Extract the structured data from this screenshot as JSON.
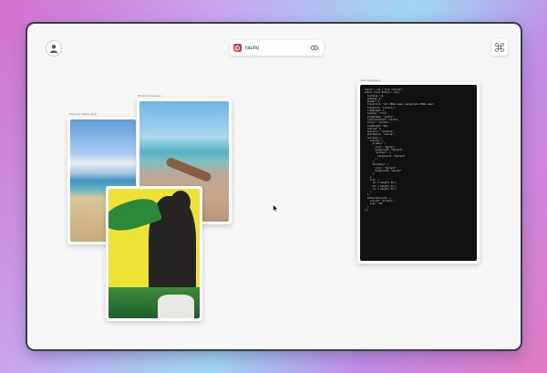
{
  "header": {
    "url_text": "rauno"
  },
  "cards": {
    "beach_label": "Photo by Nathan Jang",
    "shore_label": "Photo by Dave gus",
    "code_label": "const example.js"
  },
  "code": {
    "lines": [
      "import { css } from \"styled\";",
      "",
      "export const Button = css({",
      "  fontSize: 14,",
      "  padding: 8,",
      "  border: 0,",
      "  transition: \"all 200ms ease, background 200ms ease\",",
      "  transform: \"scale(1)\",",
      "  lineHeight: 1,",
      "  display: \"flex\",",
      "  alignItems: \"center\",",
      "  justifyContent: \"center\",",
      "  cursor: \"pointer\",",
      "  fontWeight: 500,",
      "  outline: 0,",
      "  position: \"relative\",",
      "  whiteSpace: \"nowrap\",",
      "",
      "  variants: {",
      "    variant: {",
      "      primary: {",
      "        color: \"$gray1\",",
      "        background: \"$gray12\",",
      "        \"&:hover\": {",
      "          background: \"$gray11\"",
      "        }",
      "      },",
      "      secondary: {",
      "        color: \"$gray12\",",
      "        background: \"$gray3\"",
      "      }",
      "    },",
      "    size: {",
      "      sm: { height: 28 },",
      "      md: { height: 32 },",
      "      lg: { height: 40 }",
      "    }",
      "  },",
      "  defaultVariants: {",
      "    variant: \"primary\",",
      "    size: \"md\"",
      "  }",
      "});"
    ]
  }
}
